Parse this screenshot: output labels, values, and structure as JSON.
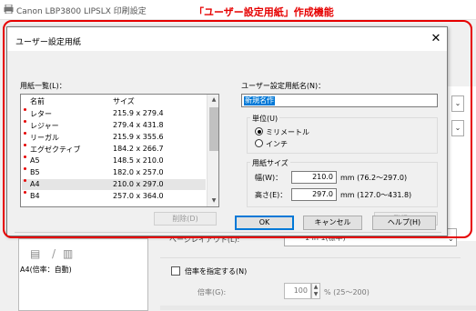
{
  "background_window": {
    "title": "Canon LBP3800 LIPSLX 印刷設定",
    "paper_status": "A4(倍率：自動)",
    "page_layout_label": "ページレイアウト(L):",
    "page_layout_value": "1 in 1(標準)",
    "magnification_checkbox_label": "倍率を指定する(N)",
    "ratio_label": "倍率(G):",
    "ratio_value": "100",
    "ratio_range": "% (25～200)"
  },
  "banner": "「ユーザー設定用紙」作成機能",
  "dialog": {
    "title": "ユーザー設定用紙",
    "close_glyph": "✕",
    "paper_list_label": "用紙一覧(L)：",
    "list_headers": {
      "name": "名前",
      "size": "サイズ"
    },
    "papers": [
      {
        "name": "レター",
        "size": "215.9 x 279.4",
        "selected": false
      },
      {
        "name": "レジャー",
        "size": "279.4 x 431.8",
        "selected": false
      },
      {
        "name": "リーガル",
        "size": "215.9 x 355.6",
        "selected": false
      },
      {
        "name": "エグゼクティブ",
        "size": "184.2 x 266.7",
        "selected": false
      },
      {
        "name": "A5",
        "size": "148.5 x 210.0",
        "selected": false
      },
      {
        "name": "B5",
        "size": "182.0 x 257.0",
        "selected": false
      },
      {
        "name": "A4",
        "size": "210.0 x 297.0",
        "selected": true
      },
      {
        "name": "B4",
        "size": "257.0 x 364.0",
        "selected": false
      }
    ],
    "delete_button": "削除(D)",
    "name_label": "ユーザー設定用紙名(N)：",
    "name_value": "新規名作",
    "unit_group_label": "単位(U)",
    "unit_options": [
      "ミリメートル",
      "インチ"
    ],
    "unit_selected": "ミリメートル",
    "size_group_label": "用紙サイズ",
    "width_label": "幅(W)：",
    "width_value": "210.0",
    "width_range": "mm (76.2～297.0)",
    "height_label": "高さ(E)：",
    "height_value": "297.0",
    "height_range": "mm (127.0～431.8)",
    "register_button": "登録(R)",
    "ok_button": "OK",
    "cancel_button": "キャンセル",
    "help_button": "ヘルプ(H)"
  },
  "colors": {
    "highlight": "#e60000",
    "selection": "#0078d7",
    "dialog_body": "#f0f0f0"
  }
}
